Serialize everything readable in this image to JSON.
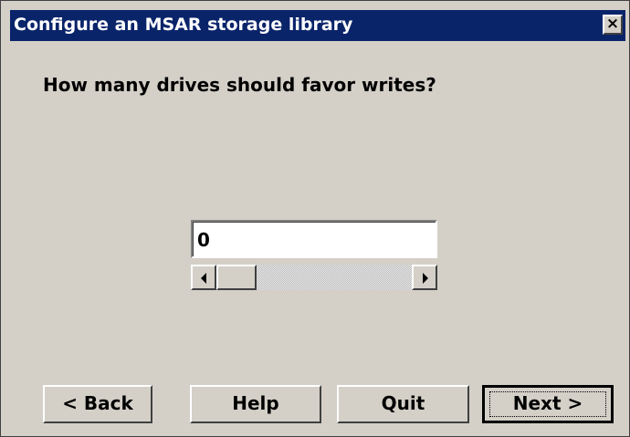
{
  "window": {
    "title": "Configure an MSAR storage library",
    "close_symbol": "×"
  },
  "main": {
    "question": "How many drives should favor writes?",
    "drive_count": "0",
    "slider_level": 0
  },
  "buttons": {
    "back": "< Back",
    "help": "Help",
    "quit": "Quit",
    "next": "Next >"
  },
  "icons": {
    "close": "close-icon",
    "scroll_left": "chevron-left-icon",
    "scroll_right": "chevron-right-icon"
  },
  "colors": {
    "title_bar": "#0a246a",
    "window_background": "#d4d0c8",
    "field_background": "#ffffff"
  }
}
